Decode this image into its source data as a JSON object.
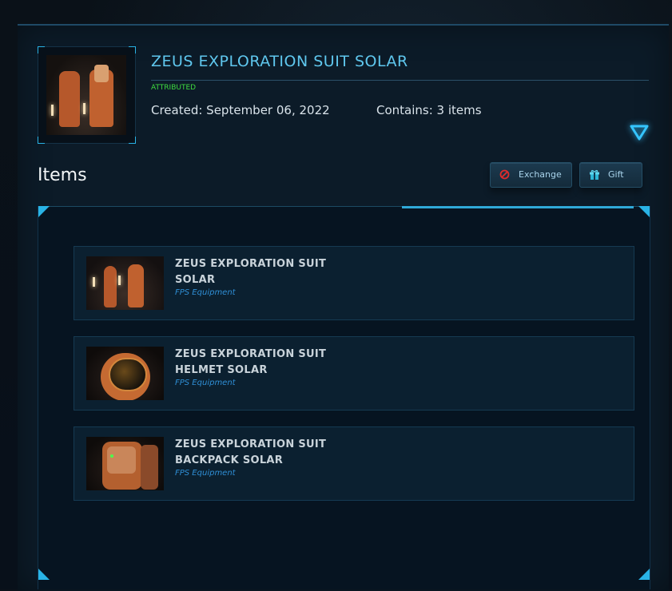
{
  "pledge": {
    "title": "ZEUS EXPLORATION SUIT SOLAR",
    "status": "ATTRIBUTED",
    "created": "Created: September 06, 2022",
    "contains": "Contains: 3 items"
  },
  "items_section": {
    "heading": "Items",
    "buttons": {
      "exchange": "Exchange",
      "gift": "Gift"
    }
  },
  "items": [
    {
      "name_line1": "ZEUS EXPLORATION SUIT",
      "name_line2": "SOLAR",
      "category": "FPS Equipment",
      "image": "suit-image"
    },
    {
      "name_line1": "ZEUS EXPLORATION SUIT",
      "name_line2": "HELMET SOLAR",
      "category": "FPS Equipment",
      "image": "helmet-image"
    },
    {
      "name_line1": "ZEUS EXPLORATION SUIT",
      "name_line2": "BACKPACK SOLAR",
      "category": "FPS Equipment",
      "image": "backpack-image"
    }
  ],
  "colors": {
    "accent": "#29b3e6",
    "title": "#5fc7ee",
    "status": "#3fdb3f",
    "category": "#2f8fd6",
    "exchange_icon": "#e02b2b"
  },
  "icons": {
    "expand": "triangle-down-icon",
    "exchange": "no-entry-icon",
    "gift": "gift-box-icon"
  }
}
